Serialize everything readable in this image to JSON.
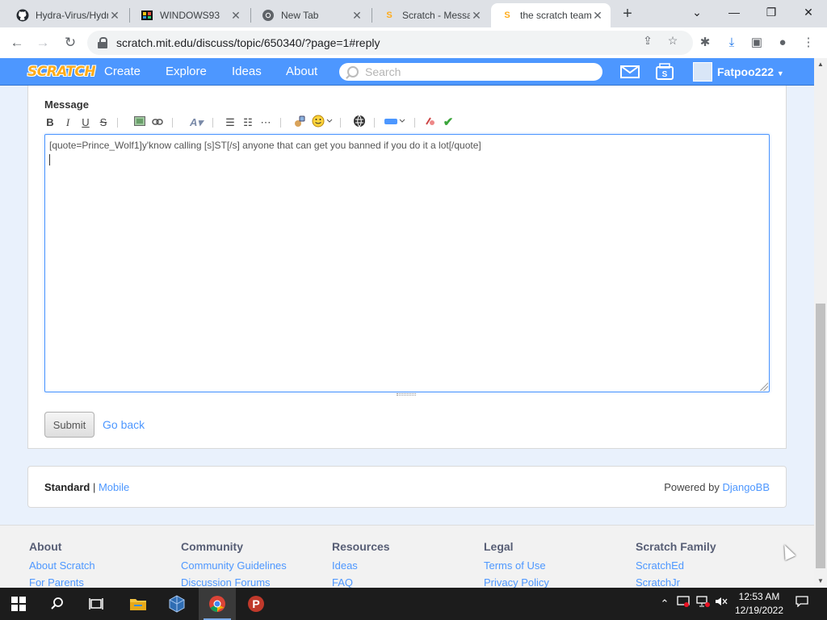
{
  "browser": {
    "tabs": [
      {
        "title": "Hydra-Virus/Hydra",
        "icon": "github-icon"
      },
      {
        "title": "WINDOWS93",
        "icon": "windows93-icon"
      },
      {
        "title": "New Tab",
        "icon": "chrome-icon"
      },
      {
        "title": "Scratch - Messages",
        "icon": "scratch-icon"
      },
      {
        "title": "the scratch team",
        "icon": "scratch-icon",
        "active": true
      }
    ],
    "new_tab_label": "+",
    "url": "scratch.mit.edu/discuss/topic/650340/?page=1#reply"
  },
  "scratch_nav": {
    "logo": "SCRATCH",
    "links": [
      "Create",
      "Explore",
      "Ideas",
      "About"
    ],
    "search_placeholder": "Search",
    "username": "Fatpoo222",
    "brand_color": "#4d97ff"
  },
  "reply_form": {
    "label": "Message",
    "toolbar": {
      "bold": "B",
      "italic": "I",
      "underline": "U",
      "strike": "S"
    },
    "message_value": "[quote=Prince_Wolf1]y'know calling [s]ST[/s] anyone that can get you banned if you do it a lot[/quote]",
    "submit_label": "Submit",
    "go_back_label": "Go back"
  },
  "forum_footer": {
    "standard_label": "Standard",
    "separator": " | ",
    "mobile_label": "Mobile",
    "powered_by": "Powered by ",
    "powered_link": "DjangoBB"
  },
  "site_footer": {
    "columns": [
      {
        "heading": "About",
        "links": [
          "About Scratch",
          "For Parents"
        ]
      },
      {
        "heading": "Community",
        "links": [
          "Community Guidelines",
          "Discussion Forums"
        ]
      },
      {
        "heading": "Resources",
        "links": [
          "Ideas",
          "FAQ"
        ]
      },
      {
        "heading": "Legal",
        "links": [
          "Terms of Use",
          "Privacy Policy"
        ]
      },
      {
        "heading": "Scratch Family",
        "links": [
          "ScratchEd",
          "ScratchJr"
        ]
      }
    ]
  },
  "taskbar": {
    "time": "12:53 AM",
    "date": "12/19/2022"
  }
}
